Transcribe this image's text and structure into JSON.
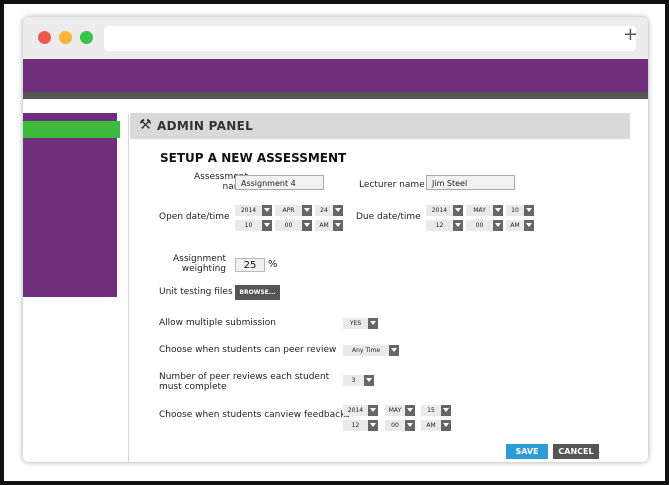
{
  "colors": {
    "brand": "#6f2f7d",
    "accent": "#3dbb3d",
    "save": "#2f9bd6",
    "cancel": "#555555"
  },
  "toolbar": {
    "new_tab_icon": "+"
  },
  "panel": {
    "icon": "wrench-screwdriver-icon",
    "title": "ADMIN PANEL"
  },
  "form": {
    "heading": "SETUP A NEW ASSESSMENT",
    "assessment_name": {
      "label_line1": "Assessment",
      "label_line2": "name",
      "value": "Assignment 4"
    },
    "lecturer_name": {
      "label": "Lecturer name",
      "value": "Jim Steel"
    },
    "open_date": {
      "label": "Open date/time",
      "year": "2014",
      "month": "APR",
      "day": "24",
      "hour": "10",
      "minute": "00",
      "ampm": "AM"
    },
    "due_date": {
      "label": "Due date/time",
      "year": "2014",
      "month": "MAY",
      "day": "10",
      "hour": "12",
      "minute": "00",
      "ampm": "AM"
    },
    "weighting": {
      "label_line1": "Assignment",
      "label_line2": "weighting",
      "value": "25",
      "unit": "%"
    },
    "unit_testing": {
      "label": "Unit testing files",
      "button": "BROWSE..."
    },
    "multiple_submission": {
      "label": "Allow multiple submission",
      "value": "YES"
    },
    "peer_review_when": {
      "label": "Choose when students can peer review",
      "value": "Any Time"
    },
    "peer_review_count": {
      "label_line1": "Number of peer reviews each student",
      "label_line2": "must complete",
      "value": "3"
    },
    "feedback_when": {
      "label": "Choose when students canview feedbacks",
      "year": "2014",
      "month": "MAY",
      "day": "15",
      "hour": "12",
      "minute": "00",
      "ampm": "AM"
    },
    "save_label": "SAVE",
    "cancel_label": "CANCEL"
  }
}
